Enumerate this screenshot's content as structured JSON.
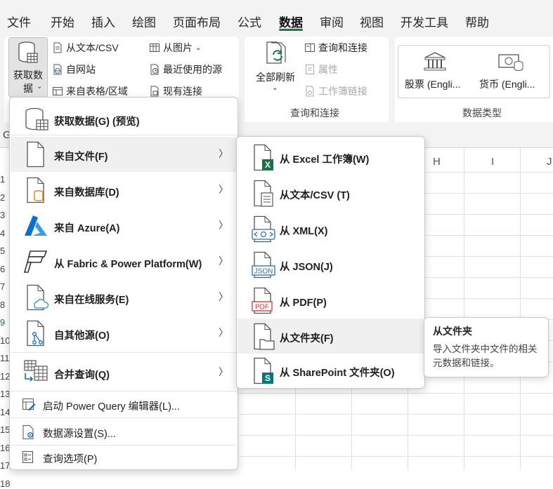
{
  "tabs": [
    "文件",
    "开始",
    "插入",
    "绘图",
    "页面布局",
    "公式",
    "数据",
    "审阅",
    "视图",
    "开发工具",
    "帮助"
  ],
  "active_tab": "数据",
  "ribbon": {
    "get_data": "获取数\n据",
    "from_text_csv": "从文本/CSV",
    "from_web": "自网站",
    "from_table": "来自表格/区域",
    "from_picture": "从图片",
    "recent_sources": "最近使用的源",
    "existing_connections": "现有连接",
    "refresh_all": "全部刷新",
    "queries_connections": "查询和连接",
    "properties": "属性",
    "workbook_links": "工作簿链接",
    "group_queries": "查询和连接",
    "stocks": "股票 (Engli...",
    "currency": "货币 (Engli...",
    "group_datatypes": "数据类型"
  },
  "grid": {
    "namebox_fragment": "G",
    "columns": [
      "H",
      "I",
      "J"
    ],
    "rows": [
      "1",
      "2",
      "3",
      "4",
      "5",
      "6",
      "7",
      "8",
      "9",
      "10",
      "11",
      "12",
      "13",
      "14",
      "15",
      "16",
      "17",
      "18"
    ]
  },
  "main_menu": {
    "items": [
      {
        "label": "获取数据(G) (预览)",
        "icon": "database-table-icon",
        "submenu": false
      },
      {
        "label": "来自文件(F)",
        "icon": "file-icon",
        "submenu": true
      },
      {
        "label": "来自数据库(D)",
        "icon": "database-file-icon",
        "submenu": true
      },
      {
        "label": "来自 Azure(A)",
        "icon": "azure-icon",
        "submenu": true
      },
      {
        "label": "从 Fabric & Power Platform(W)",
        "icon": "fabric-icon",
        "submenu": true
      },
      {
        "label": "来自在线服务(E)",
        "icon": "cloud-file-icon",
        "submenu": true
      },
      {
        "label": "自其他源(O)",
        "icon": "other-source-icon",
        "submenu": true
      },
      {
        "label": "合并查询(Q)",
        "icon": "combine-query-icon",
        "submenu": true
      },
      {
        "label": "启动 Power Query 编辑器(L)...",
        "icon": "query-editor-icon",
        "submenu": false
      },
      {
        "label": "数据源设置(S)...",
        "icon": "data-source-settings-icon",
        "submenu": false
      },
      {
        "label": "查询选项(P)",
        "icon": "query-options-icon",
        "submenu": false
      }
    ]
  },
  "sub_menu": {
    "items": [
      {
        "label": "从 Excel 工作簿(W)",
        "icon": "excel-file-icon"
      },
      {
        "label": "从文本/CSV (T)",
        "icon": "text-file-icon"
      },
      {
        "label": "从 XML(X)",
        "icon": "xml-file-icon"
      },
      {
        "label": "从 JSON(J)",
        "icon": "json-file-icon"
      },
      {
        "label": "从 PDF(P)",
        "icon": "pdf-file-icon"
      },
      {
        "label": "从文件夹(F)",
        "icon": "folder-file-icon"
      },
      {
        "label": "从 SharePoint 文件夹(O)",
        "icon": "sharepoint-file-icon"
      }
    ]
  },
  "tooltip": {
    "title": "从文件夹",
    "body": "导入文件夹中文件的相关元数据和链接。"
  },
  "colors": {
    "accent": "#107c41",
    "excel_green": "#1e7145",
    "azure_blue": "#0a6fd1",
    "pdf_red": "#d13438",
    "xml_blue": "#2b6cb0"
  }
}
